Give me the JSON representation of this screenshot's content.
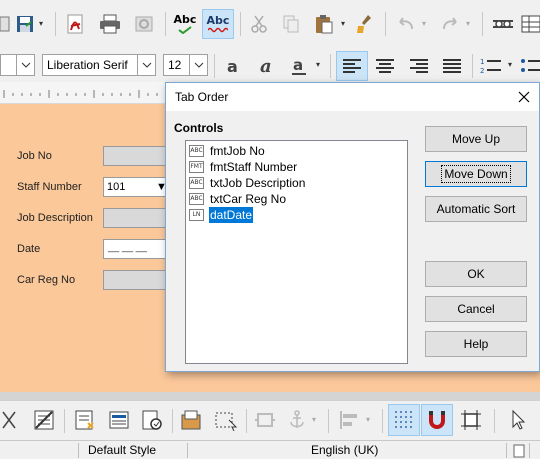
{
  "toolbar": {
    "spelling_label": "Abc",
    "autospell_label": "Abc"
  },
  "format_bar": {
    "font_name": "Liberation Serif",
    "font_size": "12"
  },
  "form": {
    "labels": [
      "Job No",
      "Staff Number",
      "Job Description",
      "Date",
      "Car Reg No"
    ],
    "staff_number_value": "101",
    "date_placeholder": "__ __ __"
  },
  "dialog": {
    "title": "Tab Order",
    "controls_label": "Controls",
    "controls": [
      {
        "icon": "ABC",
        "name": "fmtJob No"
      },
      {
        "icon": "FMT",
        "name": "fmtStaff Number"
      },
      {
        "icon": "ABC",
        "name": "txtJob Description"
      },
      {
        "icon": "ABC",
        "name": "txtCar Reg No"
      },
      {
        "icon": "LN",
        "name": "datDate"
      }
    ],
    "selected_index": 4,
    "buttons": {
      "move_up": "Move Up",
      "move_down": "Move Down",
      "automatic_sort": "Automatic Sort",
      "ok": "OK",
      "cancel": "Cancel",
      "help": "Help"
    }
  },
  "status": {
    "page_style": "Default Style",
    "language": "English (UK)"
  },
  "colors": {
    "form_background": "#fbc89a",
    "selection": "#0078d7",
    "active_toolbar_button": "#cce4f7"
  }
}
